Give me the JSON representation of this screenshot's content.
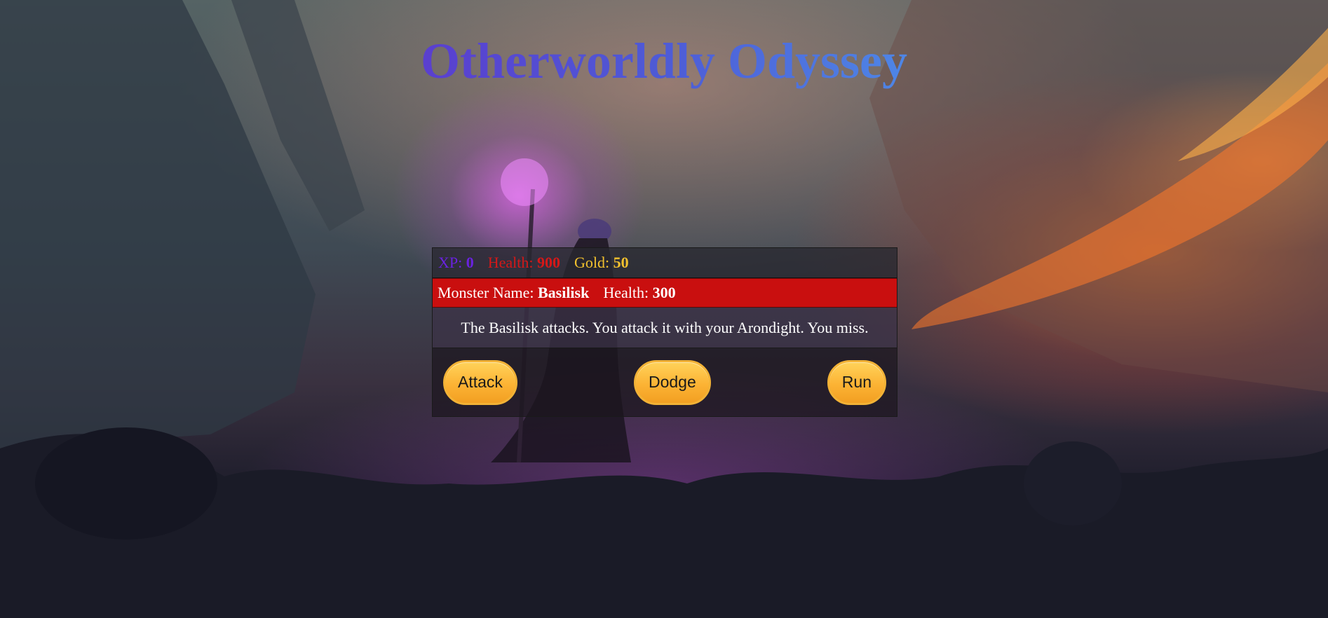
{
  "game": {
    "title": "Otherworldly Odyssey"
  },
  "stats": {
    "xp_label": "XP:",
    "xp_value": "0",
    "health_label": "Health:",
    "health_value": "900",
    "gold_label": "Gold:",
    "gold_value": "50"
  },
  "monster": {
    "name_label": "Monster Name:",
    "name_value": "Basilisk",
    "health_label": "Health:",
    "health_value": "300"
  },
  "message": {
    "text": "The Basilisk attacks. You attack it with your Arondight. You miss."
  },
  "controls": {
    "attack_label": "Attack",
    "dodge_label": "Dodge",
    "run_label": "Run"
  },
  "colors": {
    "title_gradient_start": "#5a3fcf",
    "title_gradient_end": "#4e86e6",
    "xp": "#6a22e0",
    "health": "#d41818",
    "gold": "#f2c12e",
    "monster_bar": "#c90f0f",
    "button": "#fcb334"
  }
}
